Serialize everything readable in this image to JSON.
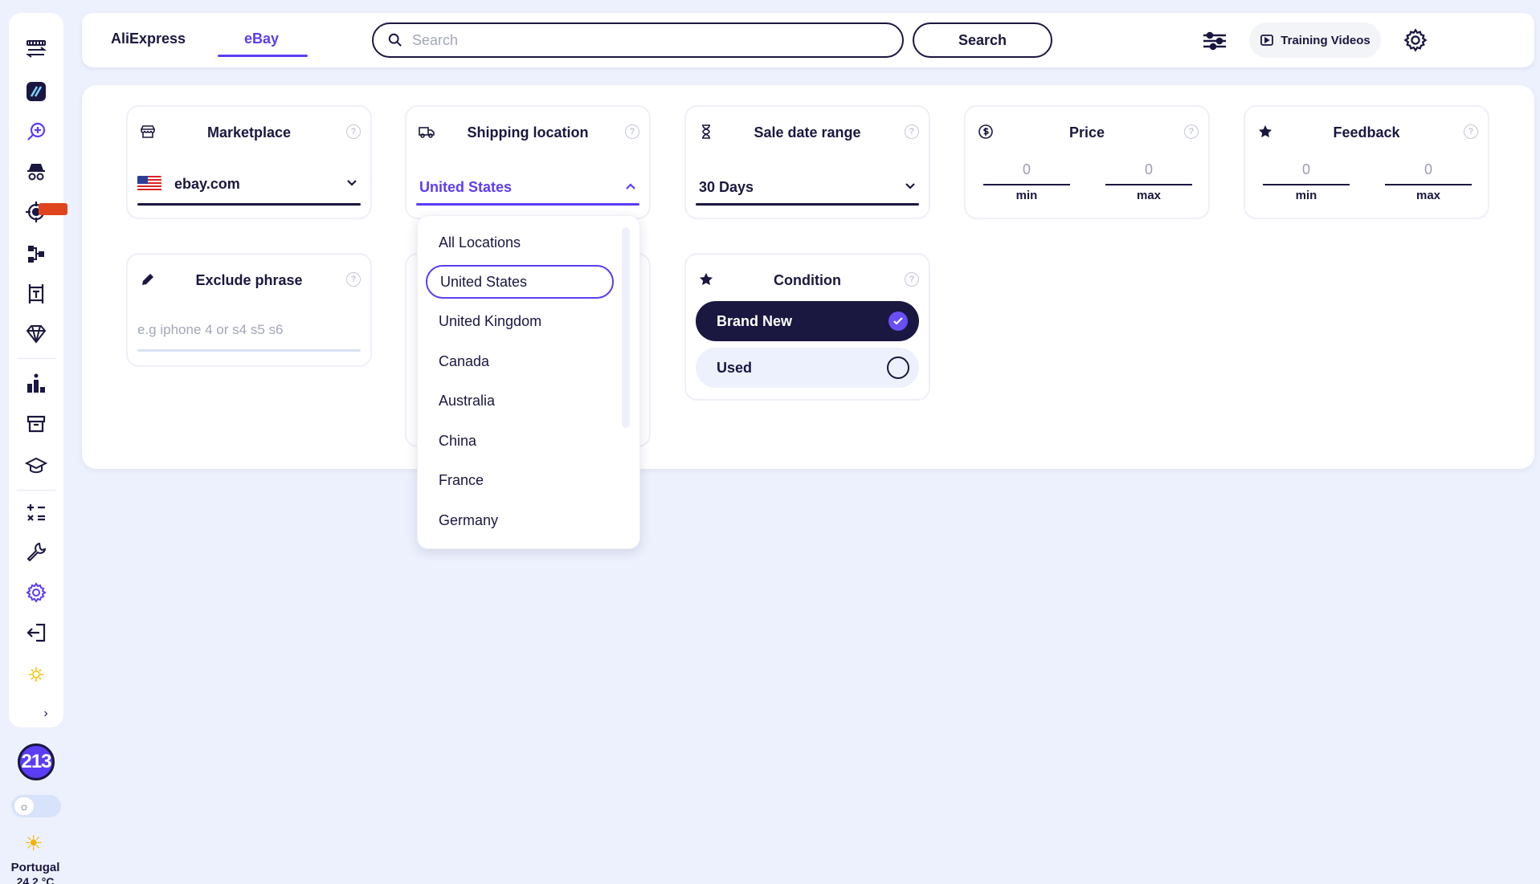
{
  "sidebar": {
    "icons": [
      "swap-icon",
      "app-logo-icon",
      "search-product-icon",
      "spy-icon",
      "target-icon",
      "flow-icon",
      "crop-icon",
      "diamond-icon",
      "ranking-icon",
      "archive-icon",
      "education-icon",
      "calculator-icon",
      "tools-icon",
      "settings-icon",
      "logout-icon",
      "sun-small-icon"
    ],
    "credits": "213",
    "weather": {
      "city": "Portugal",
      "temp": "24.2 °C"
    },
    "accent": "#5b3df5",
    "dark": "#1a1740"
  },
  "topbar": {
    "tabs": [
      {
        "label": "AliExpress",
        "active": false
      },
      {
        "label": "eBay",
        "active": true
      }
    ],
    "search_placeholder": "Search",
    "search_button": "Search",
    "training_label": "Training Videos"
  },
  "filters": {
    "marketplace": {
      "title": "Marketplace",
      "value": "ebay.com",
      "help": "?"
    },
    "shipping": {
      "title": "Shipping location",
      "value": "United States",
      "help": "?"
    },
    "sale_date": {
      "title": "Sale date range",
      "value": "30 Days",
      "help": "?"
    },
    "price": {
      "title": "Price",
      "min_value": "0",
      "max_value": "0",
      "min_label": "min",
      "max_label": "max",
      "help": "?"
    },
    "feedback": {
      "title": "Feedback",
      "min_value": "0",
      "max_value": "0",
      "min_label": "min",
      "max_label": "max",
      "help": "?"
    },
    "exclude": {
      "title": "Exclude phrase",
      "placeholder": "e.g iphone 4 or s4 s5 s6",
      "help": "?"
    },
    "condition": {
      "title": "Condition",
      "help": "?",
      "options": [
        {
          "label": "Brand New",
          "checked": true
        },
        {
          "label": "Used",
          "checked": false
        }
      ]
    }
  },
  "shipping_dropdown": {
    "selected": "United States",
    "options": [
      "All Locations",
      "United States",
      "United Kingdom",
      "Canada",
      "Australia",
      "China",
      "France",
      "Germany"
    ]
  }
}
